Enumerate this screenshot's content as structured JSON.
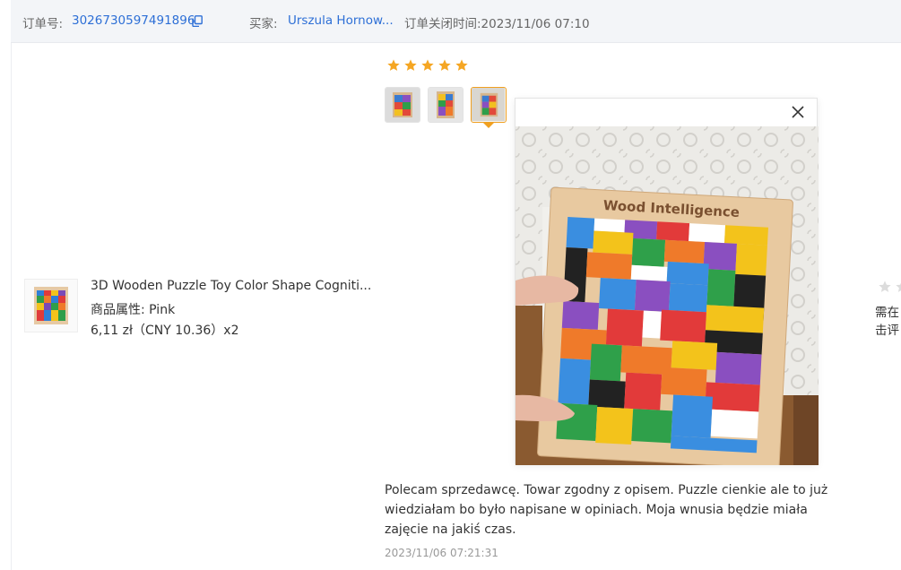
{
  "header": {
    "order_label": "订单号:",
    "order_number": "3026730597491896",
    "buyer_label": "买家:",
    "buyer_name": "Urszula Hornow...",
    "closed_time": "订单关闭时间:2023/11/06 07:10"
  },
  "product": {
    "name": "3D Wooden Puzzle Toy Color Shape Cogniti...",
    "attribute": "商品属性:  Pink",
    "price_line": "6,11 zł（CNY  10.36）x2"
  },
  "review": {
    "rating": 5,
    "text": "Polecam sprzedawcę. Towar zgodny z opisem. Puzzle cienkie ale to już wiedziałam bo było napisane w opiniach. Moja wnusia będzie miała zajęcie na jakiś czas.",
    "date": "2023/11/06 07:21:31",
    "photo_title": "Wood Intelligence"
  },
  "right_panel": {
    "note_line1": "需在",
    "note_line2": "击评"
  },
  "colors": {
    "link": "#2d6fd6",
    "star": "#f5a623",
    "active_border": "#f0a020",
    "header_bg": "#f3f5f8"
  }
}
